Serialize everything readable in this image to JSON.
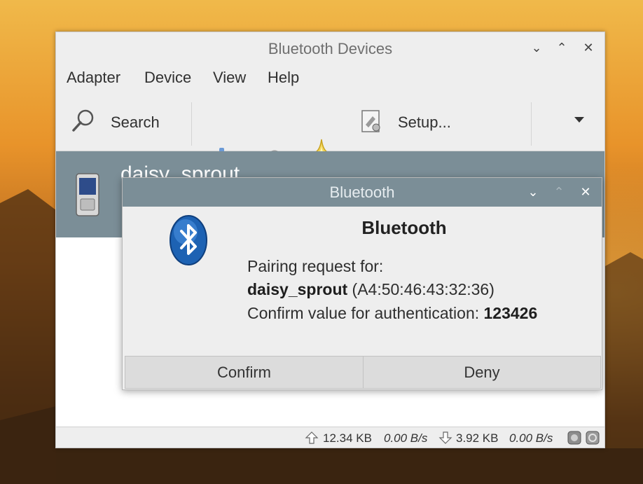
{
  "main_window": {
    "title": "Bluetooth Devices",
    "menu": [
      "Adapter",
      "Device",
      "View",
      "Help"
    ],
    "toolbar": {
      "search_label": "Search",
      "setup_label": "Setup..."
    },
    "device": {
      "name": "daisy_sprout"
    },
    "statusbar": {
      "upload_total": "12.34 KB",
      "upload_rate": "0.00 B/s",
      "download_total": "3.92 KB",
      "download_rate": "0.00 B/s"
    }
  },
  "dialog": {
    "title": "Bluetooth",
    "heading": "Bluetooth",
    "line1": "Pairing request for:",
    "device_name": "daisy_sprout",
    "device_address": "(A4:50:46:43:32:36)",
    "confirm_prefix": "Confirm value for authentication:",
    "passkey": "123426",
    "confirm_button": "Confirm",
    "deny_button": "Deny"
  },
  "colors": {
    "selection": "#7b8e97",
    "bluetooth_blue": "#1d62b3"
  }
}
